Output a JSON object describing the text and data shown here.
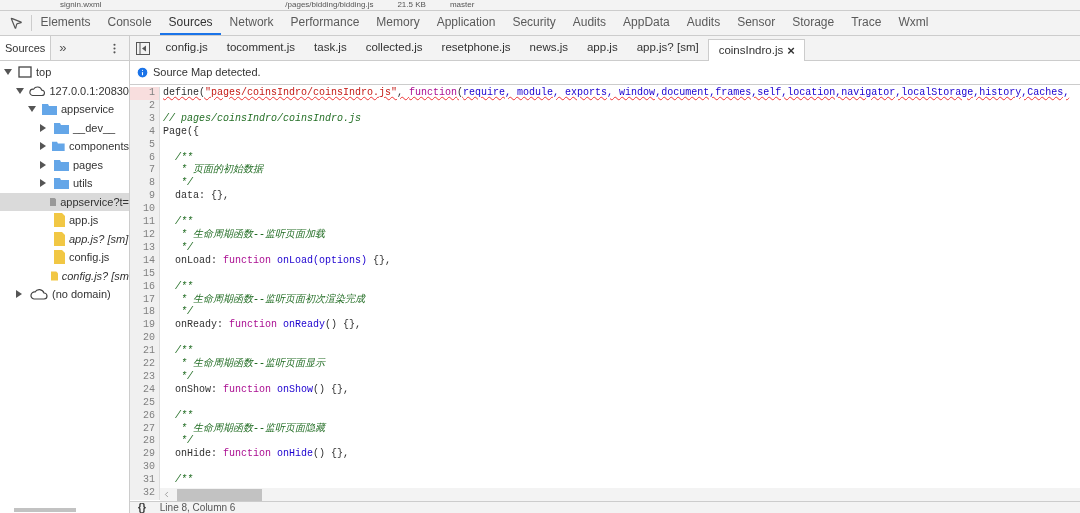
{
  "top_strip": {
    "items": [
      "signin.wxml",
      "/pages/bidding/bidding.js",
      "21.5 KB",
      "master"
    ]
  },
  "panel_tabs": [
    {
      "label": "Elements",
      "selected": false
    },
    {
      "label": "Console",
      "selected": false
    },
    {
      "label": "Sources",
      "selected": true
    },
    {
      "label": "Network",
      "selected": false
    },
    {
      "label": "Performance",
      "selected": false
    },
    {
      "label": "Memory",
      "selected": false
    },
    {
      "label": "Application",
      "selected": false
    },
    {
      "label": "Security",
      "selected": false
    },
    {
      "label": "Audits",
      "selected": false
    },
    {
      "label": "AppData",
      "selected": false
    },
    {
      "label": "Audits",
      "selected": false
    },
    {
      "label": "Sensor",
      "selected": false
    },
    {
      "label": "Storage",
      "selected": false
    },
    {
      "label": "Trace",
      "selected": false
    },
    {
      "label": "Wxml",
      "selected": false
    }
  ],
  "sidebar": {
    "tab": "Sources",
    "more": "»",
    "tree": [
      {
        "label": "top",
        "kind": "frame",
        "expanded": true,
        "selected": false,
        "children": [
          {
            "label": "127.0.0.1:20830",
            "kind": "domain",
            "expanded": true,
            "selected": false,
            "children": [
              {
                "label": "appservice",
                "kind": "folder",
                "expanded": true,
                "selected": false,
                "children": [
                  {
                    "label": "__dev__",
                    "kind": "folder",
                    "expanded": false,
                    "selected": false
                  },
                  {
                    "label": "components",
                    "kind": "folder",
                    "expanded": false,
                    "selected": false
                  },
                  {
                    "label": "pages",
                    "kind": "folder",
                    "expanded": false,
                    "selected": false
                  },
                  {
                    "label": "utils",
                    "kind": "folder",
                    "expanded": false,
                    "selected": false
                  },
                  {
                    "label": "appservice?t=",
                    "kind": "file",
                    "selected": true,
                    "mapped": false
                  },
                  {
                    "label": "app.js",
                    "kind": "script",
                    "selected": false,
                    "mapped": false
                  },
                  {
                    "label": "app.js? [sm]",
                    "kind": "script",
                    "selected": false,
                    "mapped": true
                  },
                  {
                    "label": "config.js",
                    "kind": "script",
                    "selected": false,
                    "mapped": false
                  },
                  {
                    "label": "config.js? [sm",
                    "kind": "script",
                    "selected": false,
                    "mapped": true
                  }
                ]
              }
            ]
          },
          {
            "label": "(no domain)",
            "kind": "domain",
            "expanded": false,
            "selected": false
          }
        ]
      }
    ]
  },
  "file_tabs": [
    {
      "label": "config.js",
      "selected": false
    },
    {
      "label": "tocomment.js",
      "selected": false
    },
    {
      "label": "task.js",
      "selected": false
    },
    {
      "label": "collected.js",
      "selected": false
    },
    {
      "label": "resetphone.js",
      "selected": false
    },
    {
      "label": "news.js",
      "selected": false
    },
    {
      "label": "app.js",
      "selected": false
    },
    {
      "label": "app.js? [sm]",
      "selected": false
    },
    {
      "label": "coinsIndro.js",
      "selected": true,
      "close": "×"
    }
  ],
  "info_bar": {
    "text": "Source Map detected."
  },
  "editor": {
    "lines": [
      {
        "number": "1",
        "error": true,
        "tokens": [
          {
            "kind": "plain",
            "text": "define("
          },
          {
            "kind": "string",
            "text": "\"pages/coinsIndro/coinsIndro.js\""
          },
          {
            "kind": "plain",
            "text": ", "
          },
          {
            "kind": "keyword",
            "text": "function"
          },
          {
            "kind": "plain",
            "text": "("
          },
          {
            "kind": "name",
            "text": "require, module, exports, window,document,frames,self,location,navigator,localStorage,history,Caches,"
          }
        ]
      },
      {
        "number": "2",
        "error": false
      },
      {
        "number": "3",
        "error": false,
        "tokens": [
          {
            "kind": "comment",
            "text": "// pages/coinsIndro/coinsIndro.js"
          }
        ]
      },
      {
        "number": "4",
        "error": false,
        "tokens": [
          {
            "kind": "plain",
            "text": "Page({"
          }
        ]
      },
      {
        "number": "5",
        "error": false
      },
      {
        "number": "6",
        "error": false,
        "tokens": [
          {
            "kind": "comment",
            "text": "  /**"
          }
        ]
      },
      {
        "number": "7",
        "error": false,
        "tokens": [
          {
            "kind": "comment",
            "text": "   * 页面的初始数据"
          }
        ]
      },
      {
        "number": "8",
        "error": false,
        "tokens": [
          {
            "kind": "comment",
            "text": "   */"
          }
        ]
      },
      {
        "number": "9",
        "error": false,
        "tokens": [
          {
            "kind": "plain",
            "text": "  data: {},"
          }
        ]
      },
      {
        "number": "10",
        "error": false
      },
      {
        "number": "11",
        "error": false,
        "tokens": [
          {
            "kind": "comment",
            "text": "  /**"
          }
        ]
      },
      {
        "number": "12",
        "error": false,
        "tokens": [
          {
            "kind": "comment",
            "text": "   * 生命周期函数--监听页面加载"
          }
        ]
      },
      {
        "number": "13",
        "error": false,
        "tokens": [
          {
            "kind": "comment",
            "text": "   */"
          }
        ]
      },
      {
        "number": "14",
        "error": false,
        "tokens": [
          {
            "kind": "plain",
            "text": "  onLoad: "
          },
          {
            "kind": "keyword",
            "text": "function"
          },
          {
            "kind": "name",
            "text": " onLoad(options)"
          },
          {
            "kind": "plain",
            "text": " {},"
          }
        ]
      },
      {
        "number": "15",
        "error": false
      },
      {
        "number": "16",
        "error": false,
        "tokens": [
          {
            "kind": "comment",
            "text": "  /**"
          }
        ]
      },
      {
        "number": "17",
        "error": false,
        "tokens": [
          {
            "kind": "comment",
            "text": "   * 生命周期函数--监听页面初次渲染完成"
          }
        ]
      },
      {
        "number": "18",
        "error": false,
        "tokens": [
          {
            "kind": "comment",
            "text": "   */"
          }
        ]
      },
      {
        "number": "19",
        "error": false,
        "tokens": [
          {
            "kind": "plain",
            "text": "  onReady: "
          },
          {
            "kind": "keyword",
            "text": "function"
          },
          {
            "kind": "name",
            "text": " onReady"
          },
          {
            "kind": "plain",
            "text": "() {},"
          }
        ]
      },
      {
        "number": "20",
        "error": false
      },
      {
        "number": "21",
        "error": false,
        "tokens": [
          {
            "kind": "comment",
            "text": "  /**"
          }
        ]
      },
      {
        "number": "22",
        "error": false,
        "tokens": [
          {
            "kind": "comment",
            "text": "   * 生命周期函数--监听页面显示"
          }
        ]
      },
      {
        "number": "23",
        "error": false,
        "tokens": [
          {
            "kind": "comment",
            "text": "   */"
          }
        ]
      },
      {
        "number": "24",
        "error": false,
        "tokens": [
          {
            "kind": "plain",
            "text": "  onShow: "
          },
          {
            "kind": "keyword",
            "text": "function"
          },
          {
            "kind": "name",
            "text": " onShow"
          },
          {
            "kind": "plain",
            "text": "() {},"
          }
        ]
      },
      {
        "number": "25",
        "error": false
      },
      {
        "number": "26",
        "error": false,
        "tokens": [
          {
            "kind": "comment",
            "text": "  /**"
          }
        ]
      },
      {
        "number": "27",
        "error": false,
        "tokens": [
          {
            "kind": "comment",
            "text": "   * 生命周期函数--监听页面隐藏"
          }
        ]
      },
      {
        "number": "28",
        "error": false,
        "tokens": [
          {
            "kind": "comment",
            "text": "   */"
          }
        ]
      },
      {
        "number": "29",
        "error": false,
        "tokens": [
          {
            "kind": "plain",
            "text": "  onHide: "
          },
          {
            "kind": "keyword",
            "text": "function"
          },
          {
            "kind": "name",
            "text": " onHide"
          },
          {
            "kind": "plain",
            "text": "() {},"
          }
        ]
      },
      {
        "number": "30",
        "error": false
      },
      {
        "number": "31",
        "error": false,
        "tokens": [
          {
            "kind": "comment",
            "text": "  /**"
          }
        ]
      },
      {
        "number": "32",
        "error": false
      }
    ]
  },
  "status_bar": {
    "pretty_print": "{}",
    "position": "Line 8, Column 6"
  }
}
